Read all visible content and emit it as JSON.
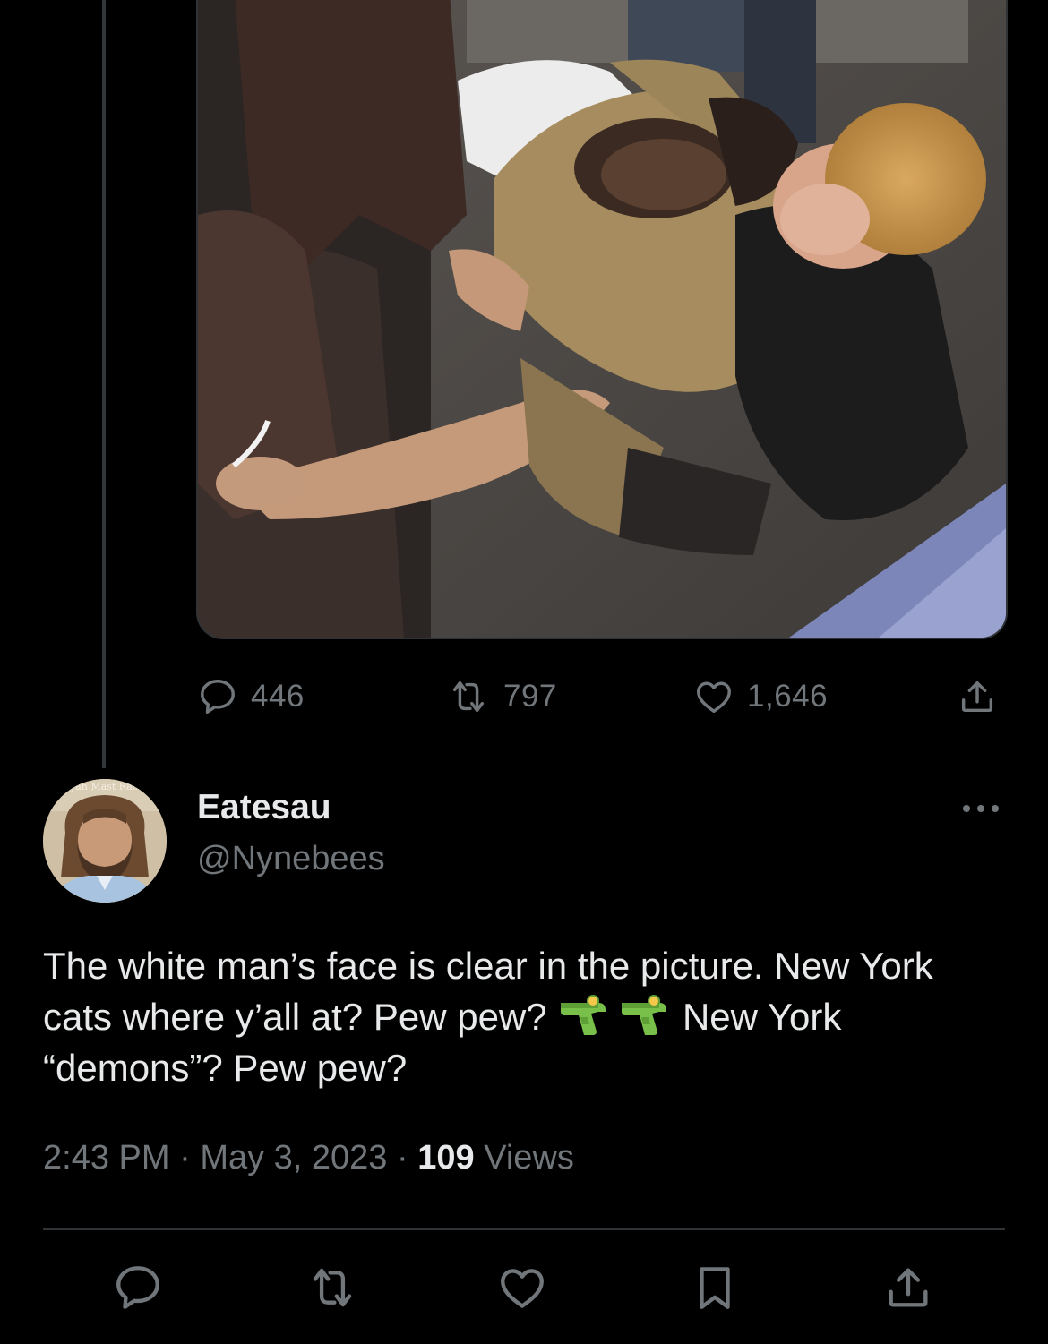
{
  "parent_tweet": {
    "media_alt": "",
    "stats": {
      "replies": "446",
      "retweets": "797",
      "likes": "1,646"
    }
  },
  "reply_tweet": {
    "avatar_caption": "yan Mast Race",
    "display_name": "Eatesau",
    "handle": "@Nynebees",
    "text_part1": "The white man’s face is clear in the picture. New York cats where y’all at? Pew pew? ",
    "text_part2": " New York “demons”? Pew pew?",
    "emoji": [
      "water-pistol",
      "water-pistol"
    ],
    "time": "2:43 PM",
    "separator": "·",
    "date": "May 3, 2023",
    "views_count": "109",
    "views_label": "Views"
  },
  "colors": {
    "background": "#000000",
    "primary_text": "#e7e9ea",
    "secondary_text": "#71767b",
    "divider": "#2f3336",
    "thread_line": "#333639"
  },
  "icons": {
    "reply": "speech-bubble-icon",
    "retweet": "retweet-icon",
    "like": "heart-icon",
    "share": "share-icon",
    "bookmark": "bookmark-icon",
    "more": "more-dots-icon"
  }
}
